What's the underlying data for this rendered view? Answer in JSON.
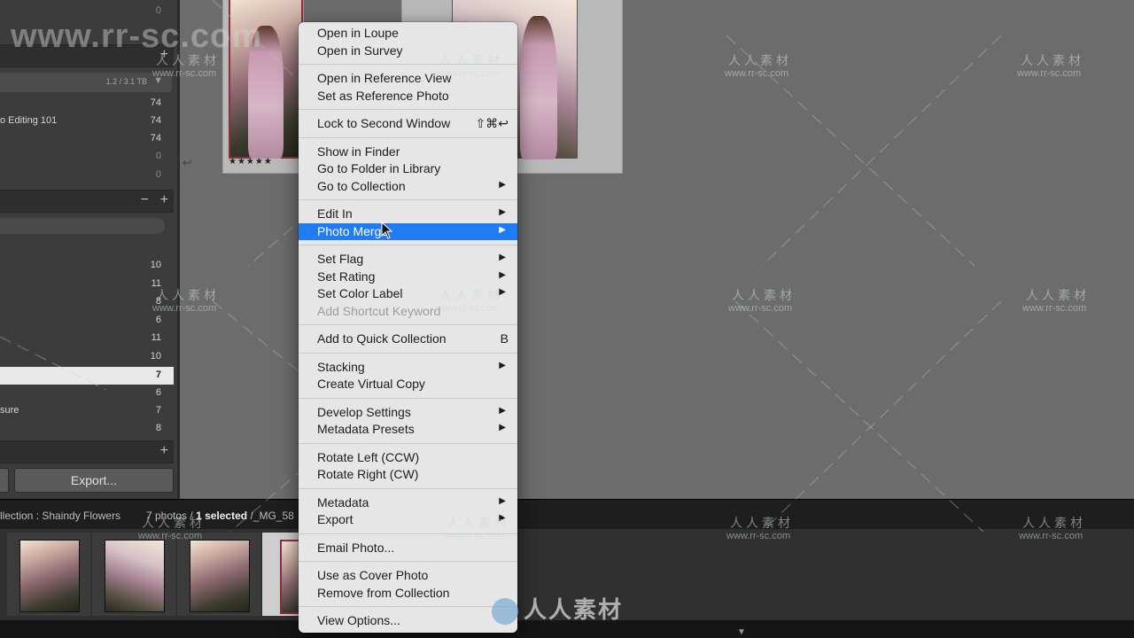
{
  "left_panel": {
    "top_count": "0",
    "rows_a": [
      {
        "label": "",
        "count": "74",
        "dim": false
      },
      {
        "label": "o Editing 101",
        "count": "74",
        "dim": false
      },
      {
        "label": "",
        "count": "74",
        "dim": false
      },
      {
        "label": "",
        "count": "0",
        "dim": true
      },
      {
        "label": "",
        "count": "0",
        "dim": true
      }
    ],
    "storage": "1.2 / 3.1 TB",
    "collections": [
      {
        "label": "",
        "count": "10",
        "selected": false
      },
      {
        "label": "",
        "count": "11",
        "selected": false
      },
      {
        "label": "",
        "count": "8",
        "selected": false
      },
      {
        "label": "",
        "count": "6",
        "selected": false
      },
      {
        "label": "",
        "count": "11",
        "selected": false
      },
      {
        "label": "",
        "count": "10",
        "selected": false
      },
      {
        "label": "",
        "count": "7",
        "selected": true
      },
      {
        "label": "",
        "count": "6",
        "selected": false
      },
      {
        "label": "sure",
        "count": "7",
        "selected": false
      },
      {
        "label": "",
        "count": "8",
        "selected": false
      }
    ],
    "export_button": "Export..."
  },
  "grid": {
    "stars": "★★★★★"
  },
  "status_bar": {
    "collection": "llection : Shaindy Flowers",
    "photos": "7 photos /",
    "selected": "1 selected",
    "filename": "/_MG_58"
  },
  "context_menu": {
    "groups": [
      [
        {
          "label": "Open in Loupe"
        },
        {
          "label": "Open in Survey"
        }
      ],
      [
        {
          "label": "Open in Reference View"
        },
        {
          "label": "Set as Reference Photo"
        }
      ],
      [
        {
          "label": "Lock to Second Window",
          "shortcut": "⇧⌘↩"
        }
      ],
      [
        {
          "label": "Show in Finder"
        },
        {
          "label": "Go to Folder in Library"
        },
        {
          "label": "Go to Collection",
          "submenu": true
        }
      ],
      [
        {
          "label": "Edit In",
          "submenu": true
        },
        {
          "label": "Photo Merge",
          "submenu": true,
          "highlighted": true
        }
      ],
      [
        {
          "label": "Set Flag",
          "submenu": true
        },
        {
          "label": "Set Rating",
          "submenu": true
        },
        {
          "label": "Set Color Label",
          "submenu": true
        },
        {
          "label": "Add Shortcut Keyword",
          "disabled": true
        }
      ],
      [
        {
          "label": "Add to Quick Collection",
          "shortcut": "B"
        }
      ],
      [
        {
          "label": "Stacking",
          "submenu": true
        },
        {
          "label": "Create Virtual Copy"
        }
      ],
      [
        {
          "label": "Develop Settings",
          "submenu": true
        },
        {
          "label": "Metadata Presets",
          "submenu": true
        }
      ],
      [
        {
          "label": "Rotate Left (CCW)"
        },
        {
          "label": "Rotate Right (CW)"
        }
      ],
      [
        {
          "label": "Metadata",
          "submenu": true
        },
        {
          "label": "Export",
          "submenu": true
        }
      ],
      [
        {
          "label": "Email Photo..."
        }
      ],
      [
        {
          "label": "Use as Cover Photo"
        },
        {
          "label": "Remove from Collection"
        }
      ],
      [
        {
          "label": "View Options..."
        }
      ]
    ]
  },
  "watermark": {
    "big": "www.rr-sc.com",
    "cn": "人人素材",
    "url": "www.rr-sc.com",
    "logo": "人人素材"
  },
  "colors": {
    "menu_highlight": "#1f7cf2",
    "menu_bg": "#e6e6e6",
    "panel_bg": "#3c3c3c",
    "grid_bg": "#6c6c6c"
  }
}
